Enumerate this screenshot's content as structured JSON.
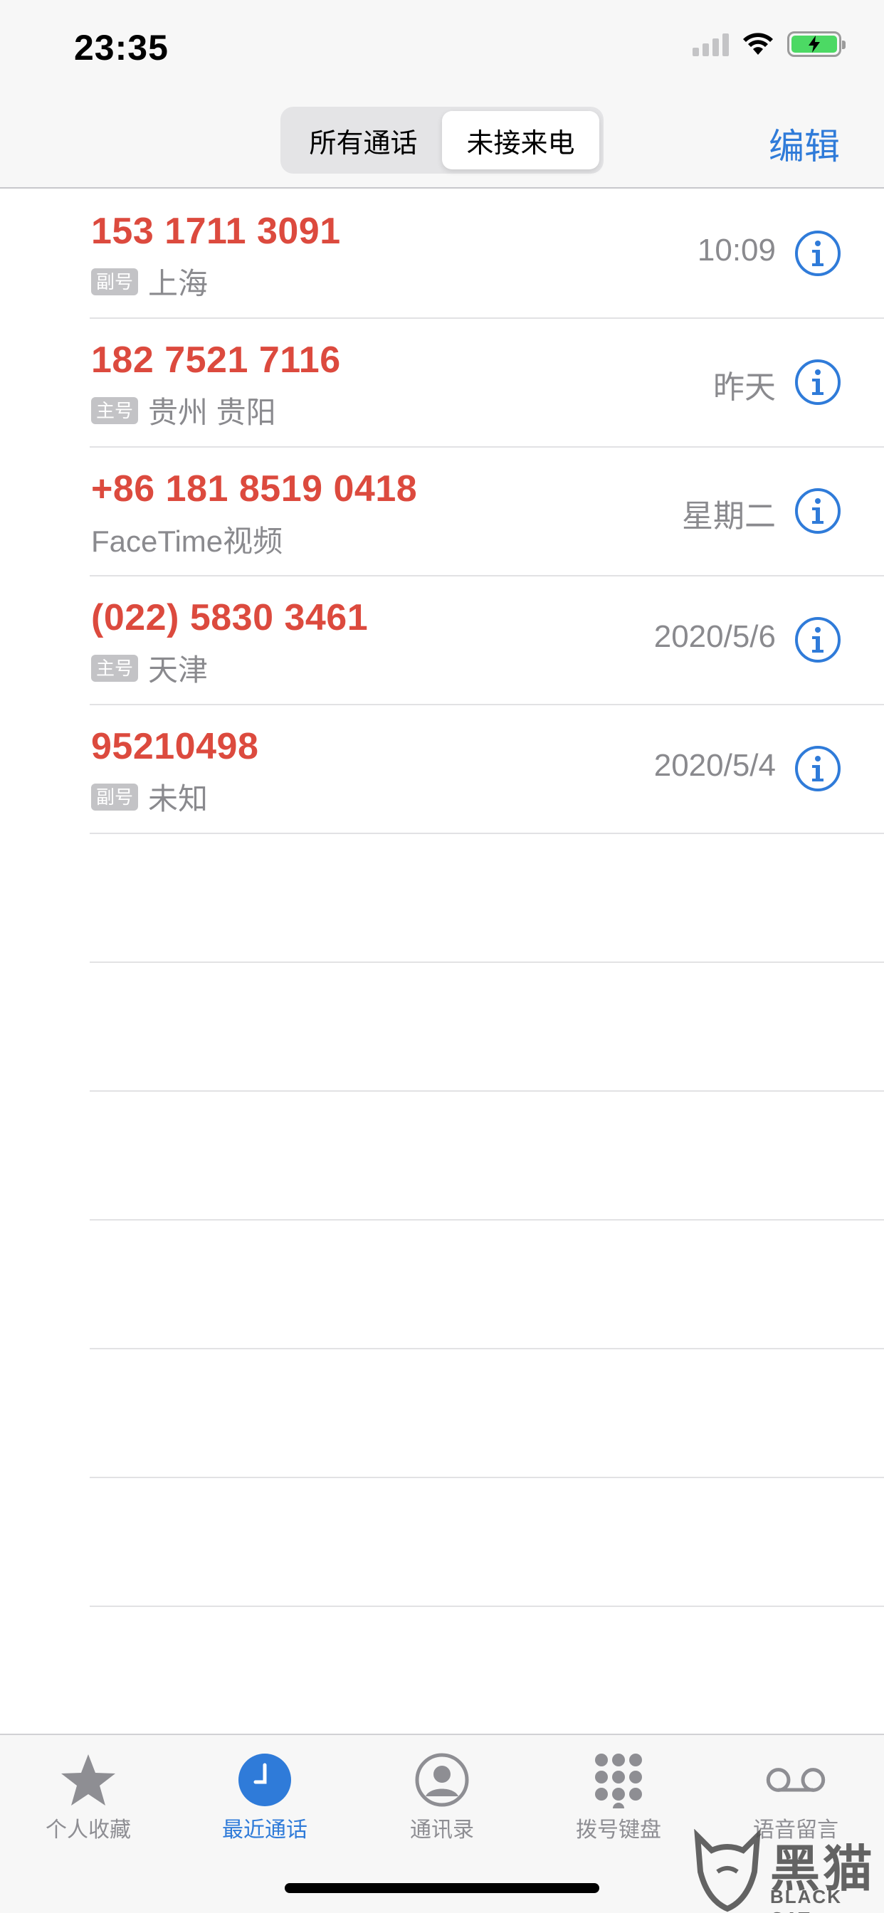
{
  "status_bar": {
    "time": "23:35",
    "icons": [
      "cellular-signal-icon",
      "wifi-icon",
      "battery-charging-icon"
    ]
  },
  "nav": {
    "segments": [
      {
        "label": "所有通话",
        "active": false
      },
      {
        "label": "未接来电",
        "active": true
      }
    ],
    "edit_label": "编辑"
  },
  "calls": [
    {
      "number": "153 1711 3091",
      "tag": "副号",
      "location": "上海",
      "time": "10:09"
    },
    {
      "number": "182 7521 7116",
      "tag": "主号",
      "location": "贵州 贵阳",
      "time": "昨天"
    },
    {
      "number": "+86 181 8519 0418",
      "tag": "",
      "location": "FaceTime视频",
      "time": "星期二"
    },
    {
      "number": "(022) 5830 3461",
      "tag": "主号",
      "location": "天津",
      "time": "2020/5/6"
    },
    {
      "number": "95210498",
      "tag": "副号",
      "location": "未知",
      "time": "2020/5/4"
    }
  ],
  "tabbar": {
    "tabs": [
      {
        "label": "个人收藏",
        "icon": "star-icon",
        "active": false
      },
      {
        "label": "最近通话",
        "icon": "clock-icon",
        "active": true
      },
      {
        "label": "通讯录",
        "icon": "person-circle-icon",
        "active": false
      },
      {
        "label": "拨号键盘",
        "icon": "keypad-icon",
        "active": false
      },
      {
        "label": "语音留言",
        "icon": "voicemail-icon",
        "active": false
      }
    ]
  },
  "watermark": {
    "cn": "黑猫",
    "en": "BLACK CAT"
  },
  "colors": {
    "missed": "#dc4a3e",
    "accent": "#2f7bd9",
    "secondary": "#8a8a8e"
  }
}
